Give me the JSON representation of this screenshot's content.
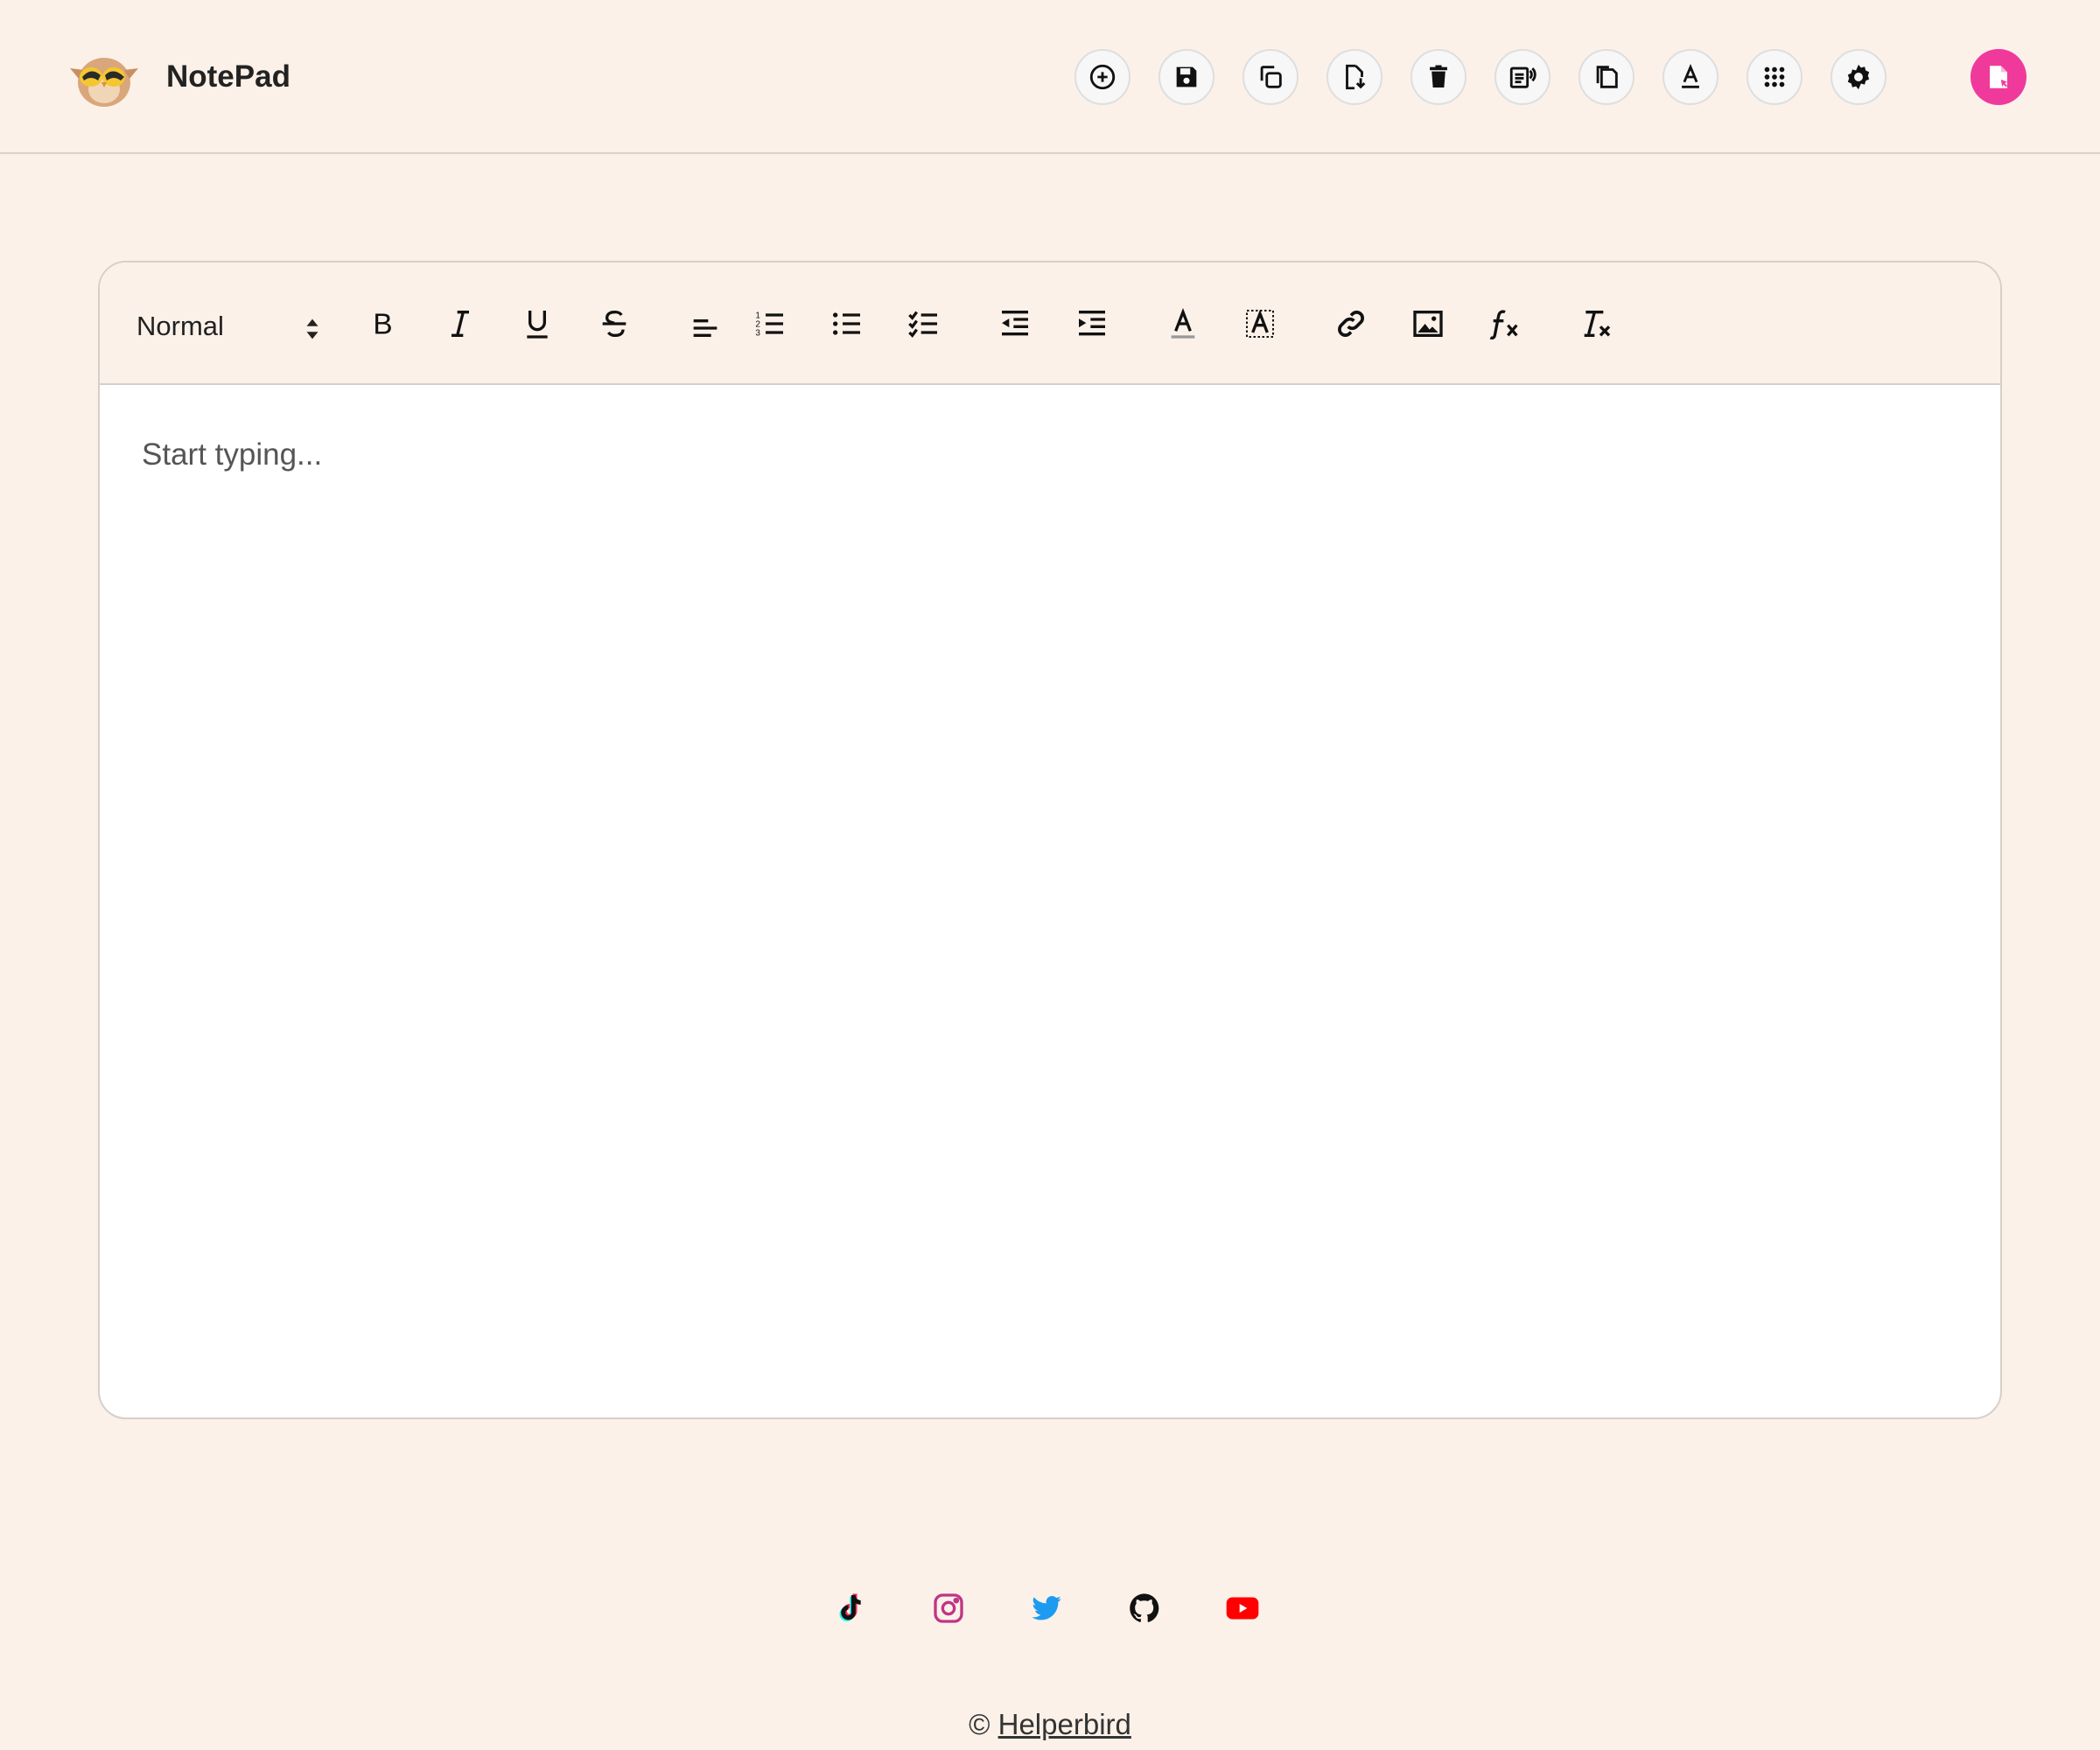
{
  "app": {
    "name": "NotePad"
  },
  "colors": {
    "accent": "#ef3a9c",
    "background": "#fbf1e9"
  },
  "header_actions": [
    {
      "name": "new-note",
      "icon": "plus-circle-icon"
    },
    {
      "name": "save",
      "icon": "floppy-icon"
    },
    {
      "name": "copy",
      "icon": "copy-icon"
    },
    {
      "name": "download",
      "icon": "file-download-icon"
    },
    {
      "name": "delete",
      "icon": "trash-icon"
    },
    {
      "name": "read-aloud",
      "icon": "speaker-doc-icon"
    },
    {
      "name": "duplicate",
      "icon": "documents-icon"
    },
    {
      "name": "font",
      "icon": "font-a-icon"
    },
    {
      "name": "apps",
      "icon": "grid-dots-icon"
    },
    {
      "name": "settings",
      "icon": "gear-icon"
    }
  ],
  "editor": {
    "heading_select": "Normal",
    "placeholder": "Start typing..."
  },
  "social": [
    "tiktok-icon",
    "instagram-icon",
    "twitter-icon",
    "github-icon",
    "youtube-icon"
  ],
  "footer": {
    "copyright": "©",
    "link_text": "Helperbird"
  }
}
